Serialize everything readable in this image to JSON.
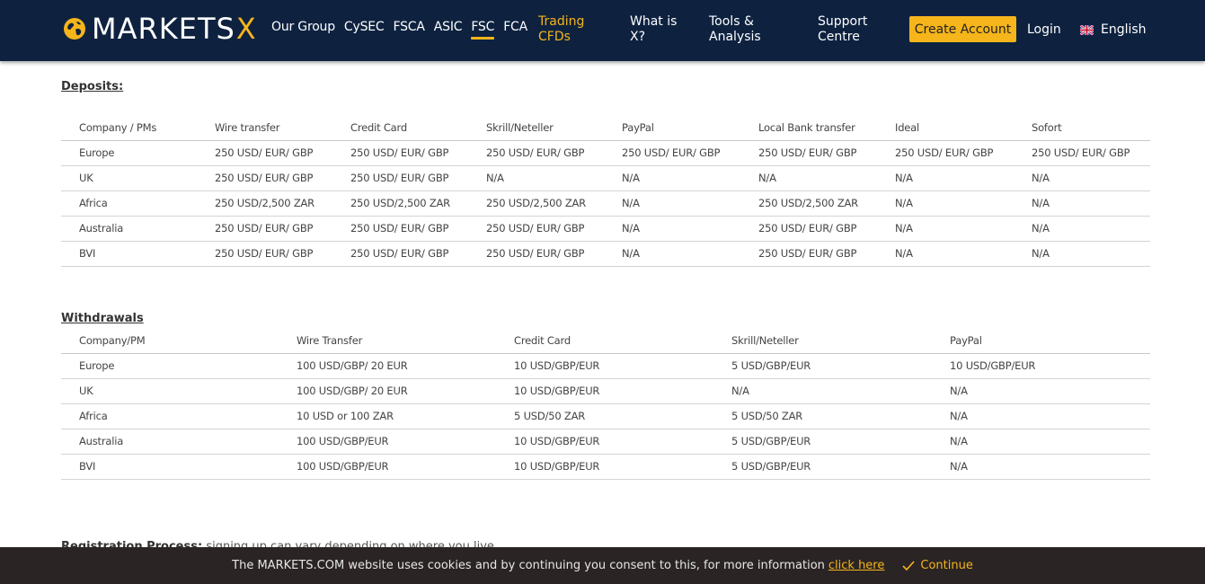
{
  "header": {
    "logo_text": "MARKETS",
    "logo_x": "X",
    "regulators": [
      "Our Group",
      "CySEC",
      "FSCA",
      "ASIC",
      "FSC",
      "FCA"
    ],
    "active_regulator": "FSC",
    "nav": {
      "trading": "Trading CFDs",
      "what_is": "What is X?",
      "tools": "Tools & Analysis",
      "support": "Support Centre"
    },
    "create_account": "Create Account",
    "login": "Login",
    "language": "English"
  },
  "deposits": {
    "title": "Deposits:",
    "headers": [
      "Company / PMs",
      "Wire transfer",
      "Credit Card",
      "Skrill/Neteller",
      "PayPal",
      "Local Bank transfer",
      "Ideal",
      "Sofort"
    ],
    "rows": [
      [
        "Europe",
        "250 USD/ EUR/ GBP",
        "250 USD/ EUR/ GBP",
        "250 USD/ EUR/ GBP",
        "250 USD/ EUR/ GBP",
        "250 USD/ EUR/ GBP",
        "250 USD/ EUR/ GBP",
        "250 USD/ EUR/ GBP"
      ],
      [
        "UK",
        "250 USD/ EUR/ GBP",
        "250 USD/ EUR/ GBP",
        "N/A",
        "N/A",
        "N/A",
        "N/A",
        "N/A"
      ],
      [
        "Africa",
        "250 USD/2,500 ZAR",
        "250 USD/2,500 ZAR",
        "250 USD/2,500 ZAR",
        "N/A",
        "250 USD/2,500 ZAR",
        "N/A",
        "N/A"
      ],
      [
        "Australia",
        "250 USD/ EUR/ GBP",
        "250 USD/ EUR/ GBP",
        "250 USD/ EUR/ GBP",
        "N/A",
        "250 USD/ EUR/ GBP",
        "N/A",
        "N/A"
      ],
      [
        "BVI",
        "250 USD/ EUR/ GBP",
        "250 USD/ EUR/ GBP",
        "250 USD/ EUR/ GBP",
        "N/A",
        "250 USD/ EUR/ GBP",
        "N/A",
        "N/A"
      ]
    ]
  },
  "withdrawals": {
    "title": "Withdrawals",
    "headers": [
      "Company/PM",
      "Wire Transfer",
      "Credit Card",
      "Skrill/Neteller",
      "PayPal"
    ],
    "rows": [
      [
        "Europe",
        "100 USD/GBP/ 20 EUR",
        "10 USD/GBP/EUR",
        "5 USD/GBP/EUR",
        "10 USD/GBP/EUR"
      ],
      [
        "UK",
        "100 USD/GBP/ 20 EUR",
        "10 USD/GBP/EUR",
        "N/A",
        "N/A"
      ],
      [
        "Africa",
        "10 USD or 100 ZAR",
        "5 USD/50 ZAR",
        "5 USD/50 ZAR",
        "N/A"
      ],
      [
        "Australia",
        "100 USD/GBP/EUR",
        "10 USD/GBP/EUR",
        "5 USD/GBP/EUR",
        "N/A"
      ],
      [
        "BVI",
        "100 USD/GBP/EUR",
        "10 USD/GBP/EUR",
        "5 USD/GBP/EUR",
        "N/A"
      ]
    ]
  },
  "registration": {
    "label": "Registration Process:",
    "text": " signing up can vary depending on where you live"
  },
  "cookie": {
    "text": "The MARKETS.COM website uses cookies and by continuing you consent to this, for more information",
    "link": "click here",
    "continue": "Continue"
  },
  "colors": {
    "header_bg": "#0e2240",
    "accent": "#f5b51b",
    "cookie_bg": "#2b2424"
  }
}
